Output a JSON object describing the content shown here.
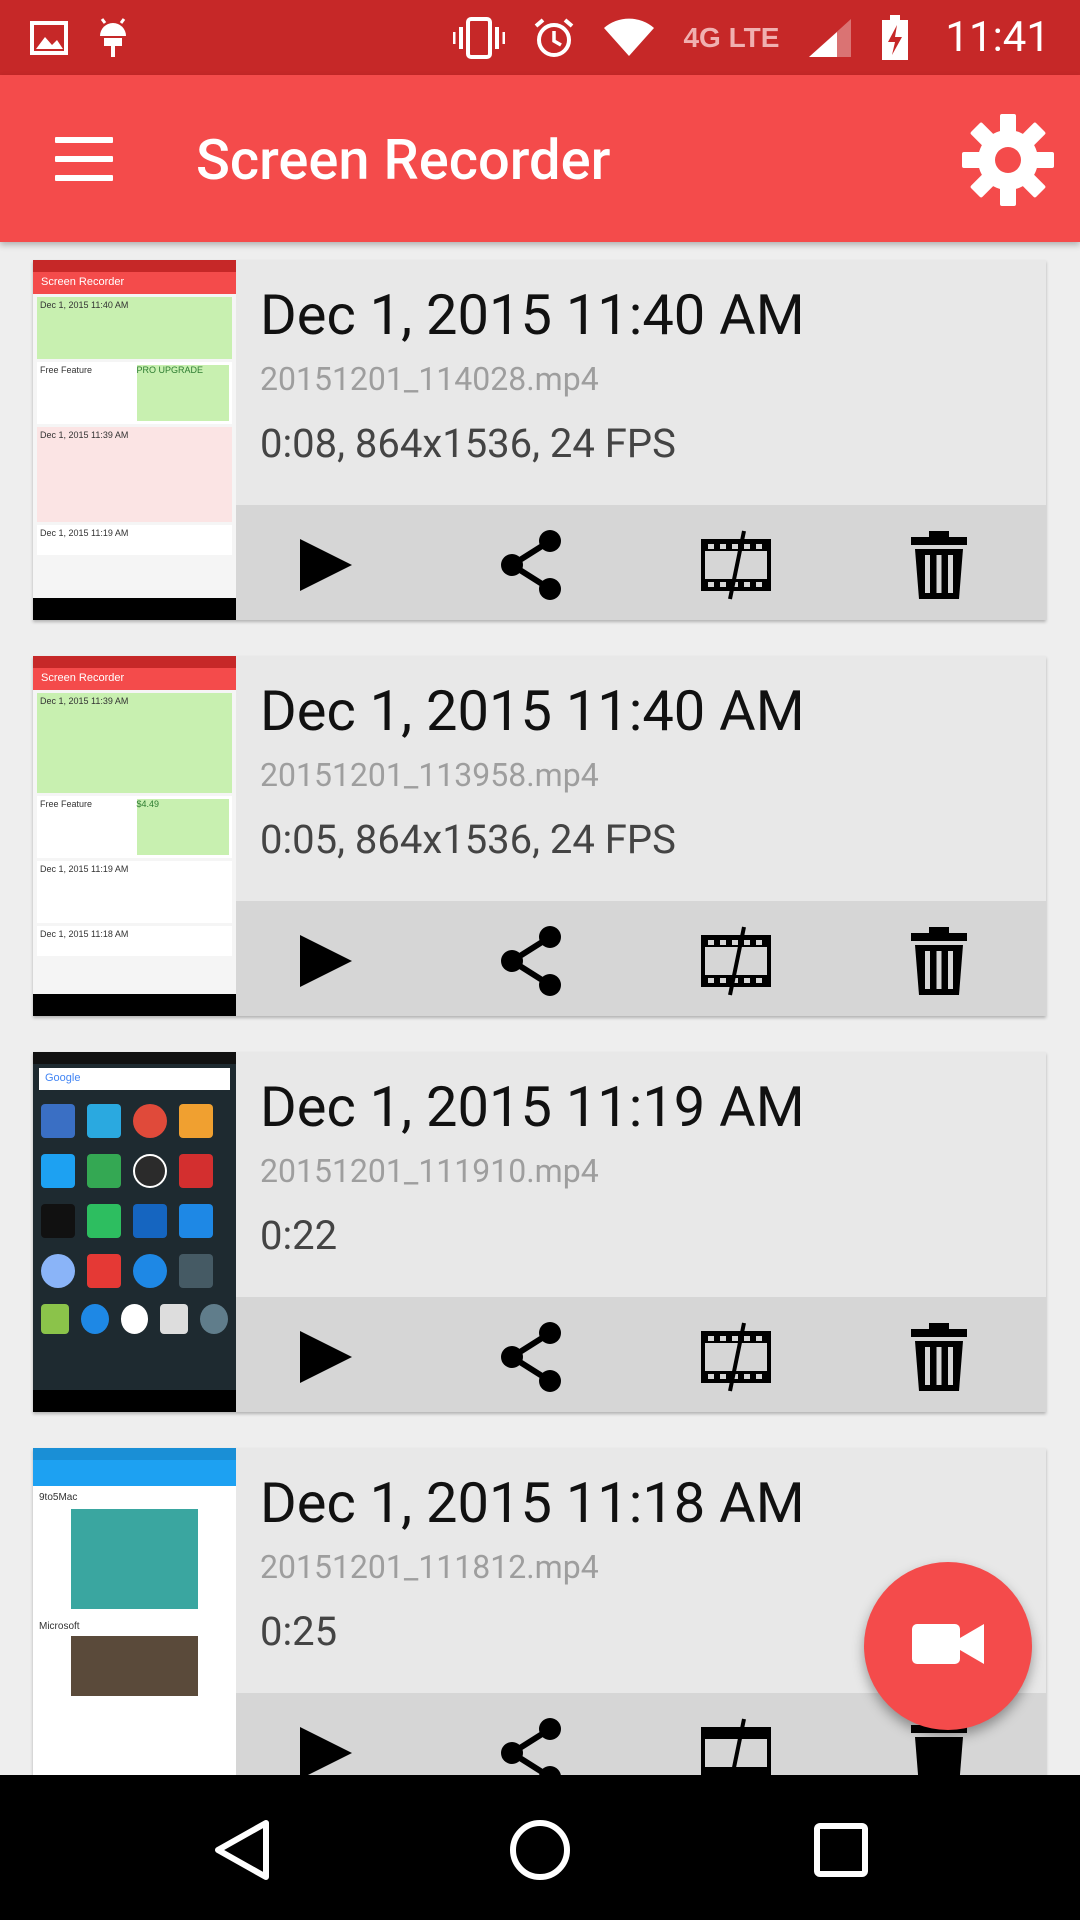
{
  "status_bar": {
    "time": "11:41",
    "network": "4G LTE",
    "icons": [
      "image-icon",
      "android-icon",
      "vibrate-icon",
      "alarm-icon",
      "wifi-icon",
      "signal-icon",
      "battery-charging-icon"
    ]
  },
  "app_bar": {
    "title": "Screen Recorder",
    "menu_icon": "menu-icon",
    "settings_icon": "gear-icon"
  },
  "recordings": [
    {
      "title": "Dec 1, 2015 11:40 AM",
      "file": "20151201_114028.mp4",
      "meta": "0:08, 864x1536, 24 FPS"
    },
    {
      "title": "Dec 1, 2015 11:40 AM",
      "file": "20151201_113958.mp4",
      "meta": "0:05, 864x1536, 24 FPS"
    },
    {
      "title": "Dec 1, 2015 11:19 AM",
      "file": "20151201_111910.mp4",
      "meta": "0:22"
    },
    {
      "title": "Dec 1, 2015 11:18 AM",
      "file": "20151201_111812.mp4",
      "meta": "0:25"
    }
  ],
  "thumbnail_text": {
    "app_title": "Screen Recorder",
    "entry_a": "Dec 1, 2015 11:40 AM",
    "entry_b": "Dec 1, 2015 11:39 AM",
    "entry_c": "Dec 1, 2015 11:19 AM",
    "entry_d": "Dec 1, 2015 11:18 AM",
    "pro": "PRO UPGRADE",
    "free": "Free Feature",
    "price": "$4.49",
    "google": "Google",
    "tweet_author": "9to5Mac",
    "tweet_author_2": "Microsoft"
  },
  "actions": [
    "play-icon",
    "share-icon",
    "trim-icon",
    "delete-icon"
  ],
  "fab_icon": "videocam-icon",
  "nav": [
    "back-icon",
    "home-icon",
    "recents-icon"
  ],
  "colors": {
    "status_bar": "#c62828",
    "app_bar": "#f44b4b",
    "fab": "#f44b4b",
    "card": "#e8e8e8",
    "action_row": "#d6d6d6"
  }
}
